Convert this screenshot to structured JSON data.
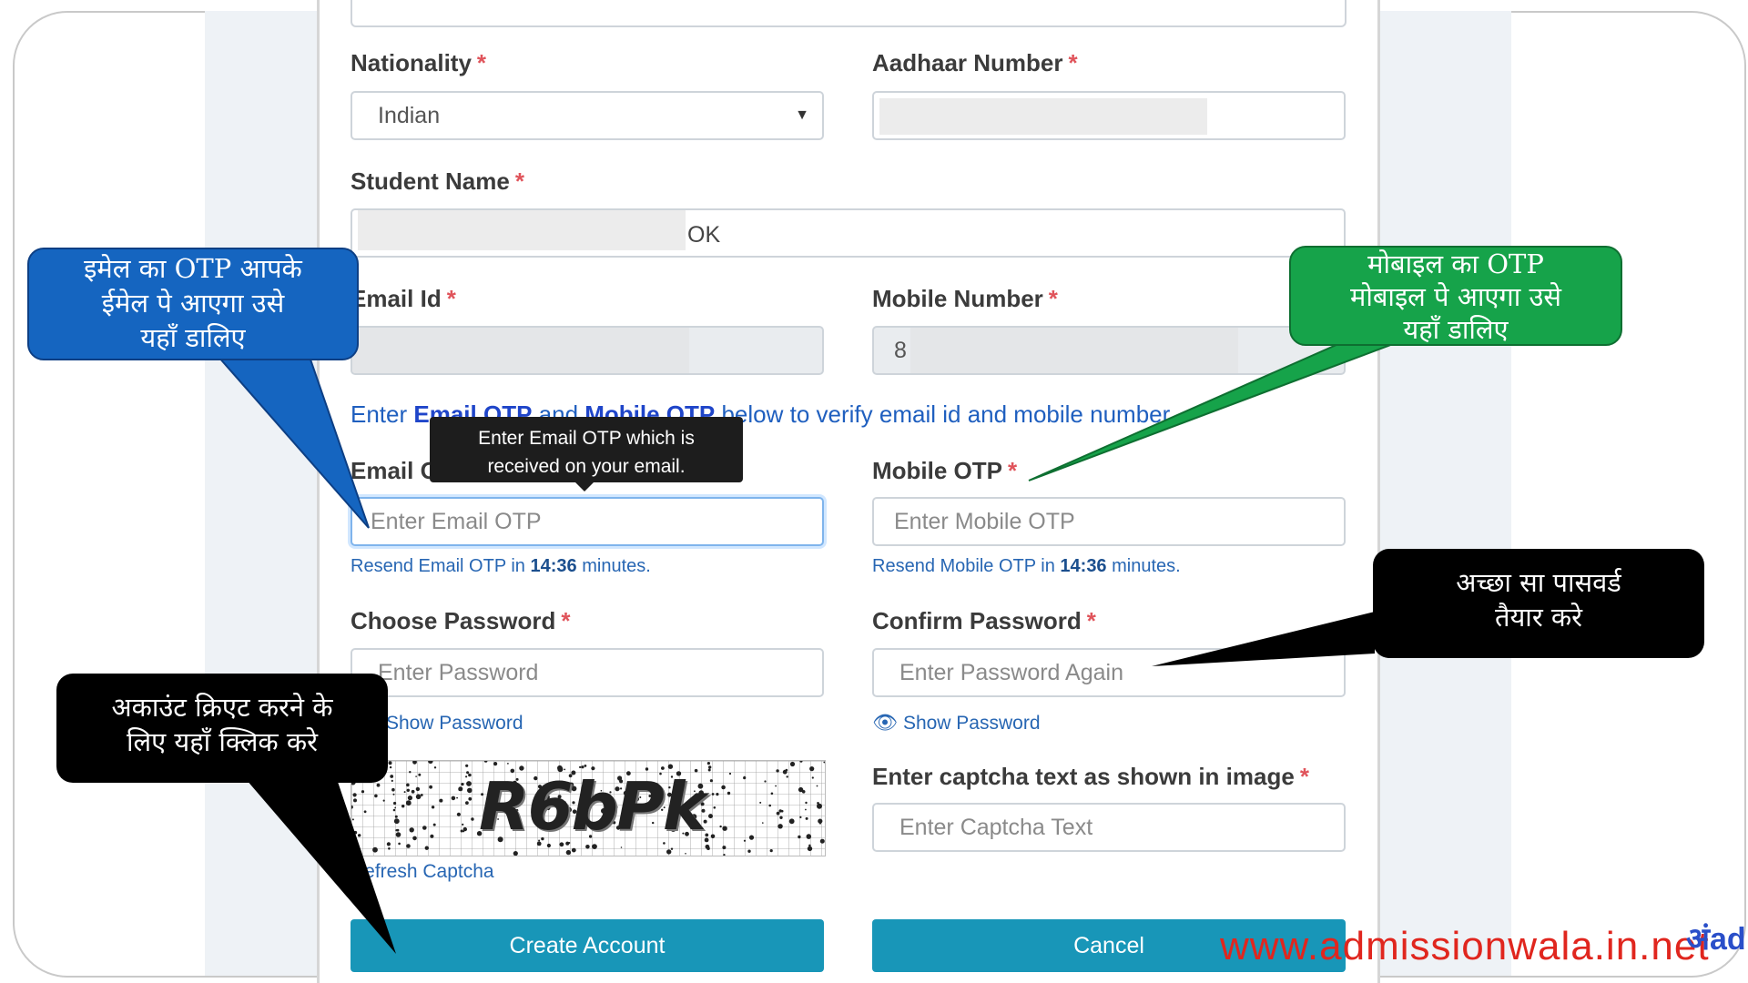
{
  "form": {
    "nationality_label": "Nationality",
    "nationality_value": "Indian",
    "aadhaar_label": "Aadhaar Number",
    "student_name_label": "Student Name",
    "student_name_value": "OK",
    "email_label": "Email Id",
    "mobile_label": "Mobile Number",
    "mobile_value": "8",
    "verify_info": {
      "prefix": "Enter ",
      "email_otp": "Email OTP",
      "and": " and ",
      "mobile_otp": "Mobile OTP",
      "suffix": " below to verify email id and mobile number."
    },
    "email_otp_label": "Email OTP",
    "email_otp_placeholder": "Enter Email OTP",
    "resend_email_prefix": "Resend Email OTP in ",
    "resend_email_time": "14:36",
    "resend_suffix": " minutes.",
    "mobile_otp_label": "Mobile OTP",
    "mobile_otp_placeholder": "Enter Mobile OTP",
    "resend_mobile_prefix": "Resend Mobile OTP in ",
    "resend_mobile_time": "14:36",
    "choose_password_label": "Choose Password",
    "password_placeholder": "Enter Password",
    "show_password": "Show Password",
    "confirm_password_label": "Confirm Password",
    "confirm_password_placeholder": "Enter Password Again",
    "captcha_text": "R6bPk",
    "refresh_captcha": "Refresh Captcha",
    "captcha_label": "Enter captcha text as shown in image",
    "captcha_placeholder": "Enter Captcha Text",
    "create_account": "Create Account",
    "cancel": "Cancel",
    "required_mark": "*"
  },
  "tooltip": {
    "line1": "Enter Email OTP which is",
    "line2": "received on your email."
  },
  "callouts": {
    "email_otp": [
      "इमेल  का OTP आपके",
      "ईमेल पे आएगा उसे",
      "यहाँ डालिए"
    ],
    "mobile_otp": [
      "मोबाइल का OTP",
      "मोबाइल पे आएगा उसे",
      "यहाँ डालिए"
    ],
    "password": [
      "अच्छा सा पासवर्ड",
      "तैयार करे"
    ],
    "create": [
      "अकाउंट क्रिएट करने के",
      "लिए यहाँ क्लिक करे"
    ]
  },
  "watermark": "www.admissionwala.in.net",
  "watermark_logo": "अंad",
  "colors": {
    "button": "#1896b8",
    "link": "#2766b3",
    "required": "#e0545b",
    "callout_blue": "#1565c0",
    "callout_green": "#16a34a",
    "watermark": "#e0261e"
  }
}
